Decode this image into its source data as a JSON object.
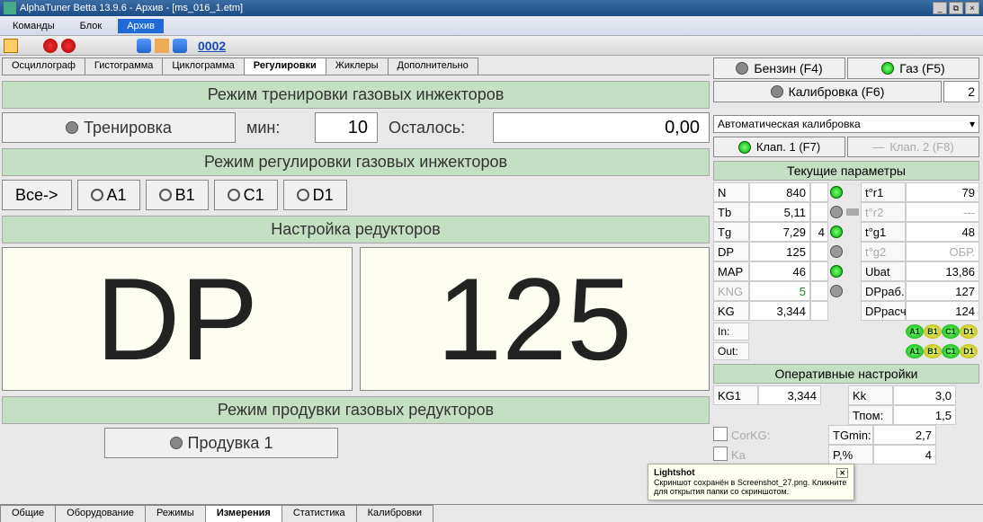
{
  "titlebar": {
    "text": "AlphaTuner Betta 13.9.6 - Архив - [ms_016_1.etm]"
  },
  "menubar": {
    "items": [
      "Команды",
      "Блок",
      "Архив"
    ],
    "active": 2
  },
  "toolbar": {
    "counter": "0002"
  },
  "top_tabs": {
    "items": [
      "Осциллограф",
      "Гистограмма",
      "Циклограмма",
      "Регулировки",
      "Жиклеры",
      "Дополнительно"
    ],
    "active": 3
  },
  "training": {
    "header": "Режим тренировки газовых инжекторов",
    "button": "Тренировка",
    "min_label": "мин:",
    "min_value": "10",
    "left_label": "Осталось:",
    "left_value": "0,00"
  },
  "regulation": {
    "header": "Режим регулировки газовых инжекторов",
    "all": "Все->",
    "cyls": [
      "A1",
      "B1",
      "C1",
      "D1"
    ]
  },
  "reducer": {
    "header": "Настройка редукторов",
    "label": "DP",
    "value": "125"
  },
  "purge": {
    "header": "Режим продувки газовых редукторов",
    "button": "Продувка 1"
  },
  "fuel": {
    "petrol": "Бензин (F4)",
    "gas": "Газ   (F5)",
    "calib": "Калибровка  (F6)",
    "calib_val": "2"
  },
  "auto_calib": "Автоматическая калибровка",
  "valves": {
    "v1": "Клап. 1 (F7)",
    "v2": "Клап. 2 (F8)"
  },
  "params": {
    "header": "Текущие параметры",
    "rows": [
      {
        "l": "N",
        "v": "840",
        "sv": "",
        "led": "green",
        "l2": "t°r1",
        "v2": "79"
      },
      {
        "l": "Tb",
        "v": "5,11",
        "sv": "",
        "led": "dim",
        "l2": "t°r2",
        "v2": "---",
        "dim2": true
      },
      {
        "l": "Tg",
        "v": "7,29",
        "sv": "4",
        "led": "green",
        "l2": "t°g1",
        "v2": "48"
      },
      {
        "l": "DP",
        "v": "125",
        "sv": "",
        "led": "dim",
        "l2": "t°g2",
        "v2": "ОБР.",
        "dim2": true,
        "showled": true
      },
      {
        "l": "MAP",
        "v": "46",
        "sv": "",
        "led": "green",
        "l2": "Ubat",
        "v2": "13,86"
      },
      {
        "l": "KNG",
        "v": "5",
        "sv": "",
        "led": "dim",
        "l2": "DPраб.",
        "v2": "127",
        "diml": true,
        "showled": true
      },
      {
        "l": "KG",
        "v": "3,344",
        "sv": "",
        "led": "",
        "l2": "DPрасч",
        "v2": "124"
      }
    ],
    "in_label": "In:",
    "out_label": "Out:",
    "cyls": [
      "A1",
      "B1",
      "C1",
      "D1"
    ]
  },
  "op": {
    "header": "Оперативные настройки",
    "kg1_l": "KG1",
    "kg1_v": "3,344",
    "kk_l": "Kk",
    "kk_v": "3,0",
    "tpom_l": "Тпом:",
    "tpom_v": "1,5",
    "corkg_l": "CorKG:",
    "tgmin_l": "TGmin:",
    "tgmin_v": "2,7",
    "ka_l": "Ka",
    "p_l": "P,%",
    "p_v": "4"
  },
  "bottom_tabs": {
    "items": [
      "Общие",
      "Оборудование",
      "Режимы",
      "Измерения",
      "Статистика",
      "Калибровки"
    ],
    "active": 3
  },
  "toast": {
    "title": "Lightshot",
    "body": "Скриншот сохранён в Screenshot_27.png. Кликните для открытия папки со скриншотом."
  }
}
